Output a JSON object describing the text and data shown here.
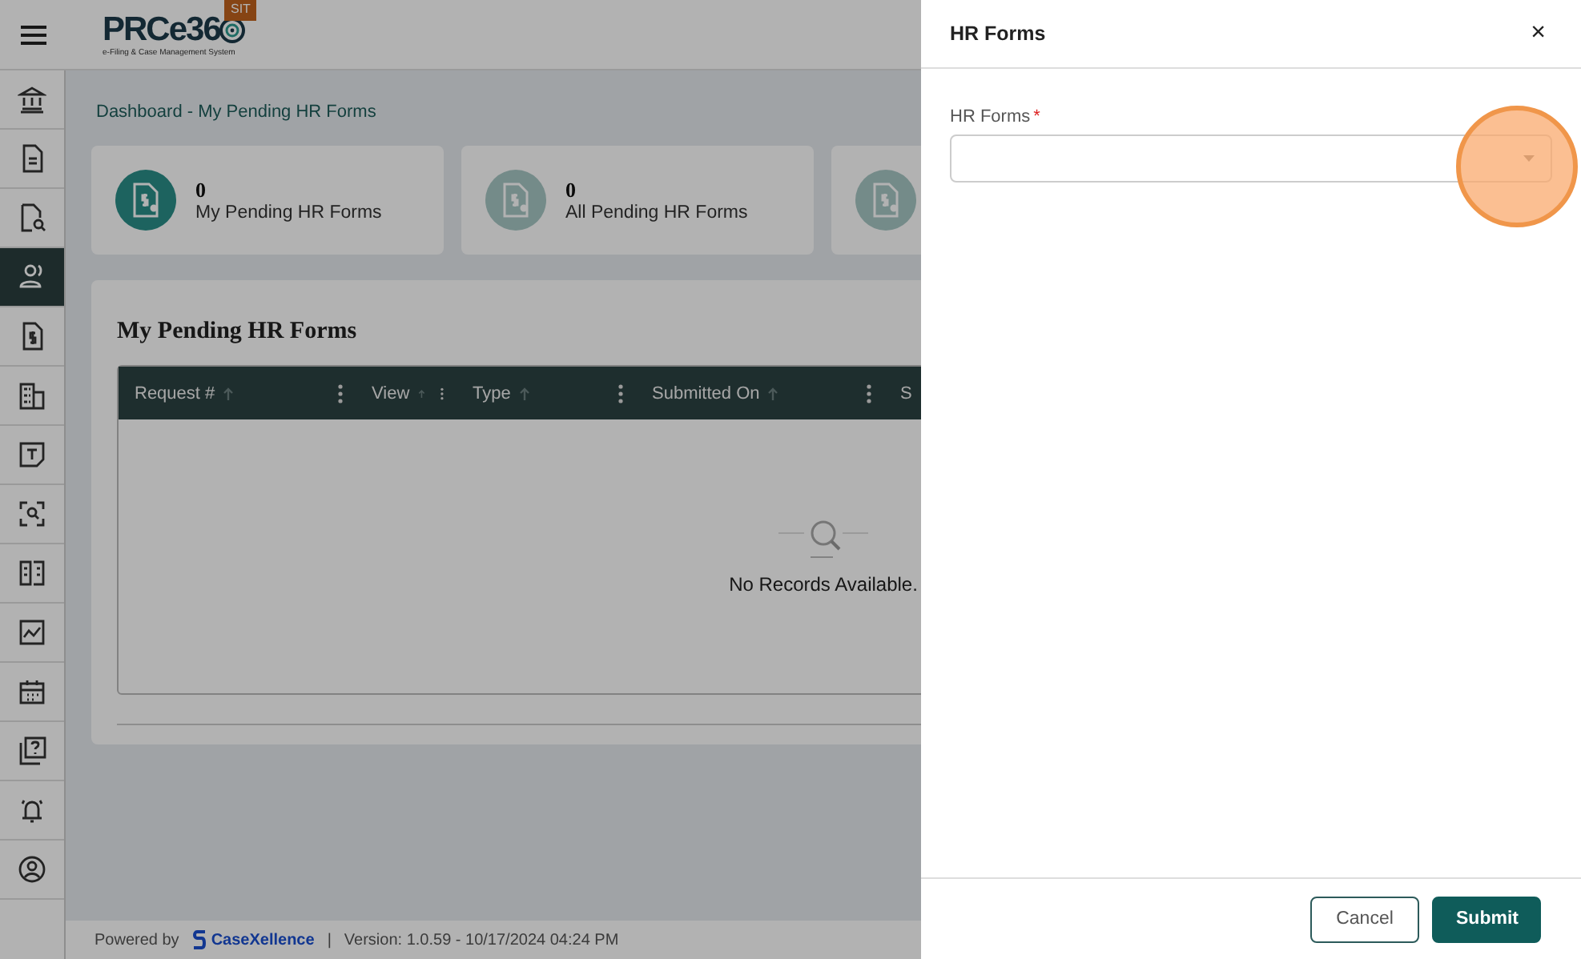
{
  "header": {
    "logo_name": "PRCe36",
    "logo_tagline": "e-Filing & Case Management System",
    "env_badge": "SIT"
  },
  "sidebar": {
    "items": [
      {
        "selected": false
      },
      {
        "selected": false
      },
      {
        "selected": false
      },
      {
        "selected": true
      },
      {
        "selected": false
      },
      {
        "selected": false
      },
      {
        "selected": false
      },
      {
        "selected": false
      },
      {
        "selected": false
      },
      {
        "selected": false
      },
      {
        "selected": false
      },
      {
        "selected": false
      },
      {
        "selected": false
      },
      {
        "selected": false
      }
    ]
  },
  "breadcrumb": "Dashboard - My Pending HR Forms",
  "stat_cards": [
    {
      "count": "0",
      "label": "My Pending HR Forms",
      "selected": true
    },
    {
      "count": "0",
      "label": "All Pending HR Forms",
      "selected": false
    },
    {
      "selected": false
    }
  ],
  "table": {
    "title": "My Pending HR Forms",
    "columns": [
      "Request #",
      "View",
      "Type",
      "Submitted On",
      "S"
    ],
    "empty_message": "No Records Available."
  },
  "footer": {
    "powered_by": "Powered by",
    "brand": "CaseXellence",
    "separator": "|",
    "version": "Version: 1.0.59 - 10/17/2024 04:24 PM"
  },
  "drawer": {
    "title": "HR Forms",
    "close": "×",
    "field": {
      "label": "HR Forms",
      "required_mark": "*"
    },
    "buttons": [
      {
        "label": "Cancel",
        "kind": "secondary"
      },
      {
        "label": "Submit",
        "kind": "primary"
      }
    ]
  }
}
